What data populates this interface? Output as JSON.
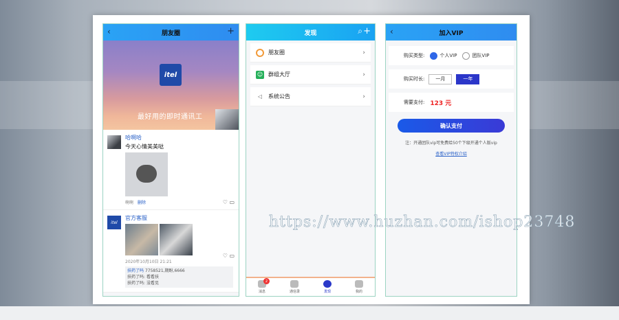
{
  "phone1": {
    "title": "朋友圈",
    "back_icon": "chevron-left-icon",
    "add_icon": "plus-icon",
    "logo_text": "itel",
    "slogan": "最好用的即时通讯工",
    "posts": [
      {
        "name": "哈啊哈",
        "text": "今天心情美美哒",
        "meta_user": "啊啊",
        "delete_label": "删除"
      },
      {
        "name": "官方客服",
        "date": "2020年10月10日 21:21",
        "comments": [
          {
            "user": "扶药了吗",
            "text": "7758521,期盼,6666"
          },
          {
            "user": "扶药了吗:",
            "text": "看看扶"
          },
          {
            "user": "扶药了吗:",
            "text": "没看见"
          }
        ]
      }
    ]
  },
  "phone2": {
    "title": "发现",
    "menu": [
      {
        "label": "朋友圈",
        "icon": "moments-icon"
      },
      {
        "label": "群组大厅",
        "icon": "group-hall-icon"
      },
      {
        "label": "系统公告",
        "icon": "speaker-icon"
      }
    ],
    "tabs": [
      {
        "label": "消息",
        "badge": "2"
      },
      {
        "label": "通信录",
        "badge": ""
      },
      {
        "label": "发现",
        "badge": ""
      },
      {
        "label": "我的",
        "badge": ""
      }
    ]
  },
  "phone3": {
    "title": "加入VIP",
    "type_label": "购买类型:",
    "type_personal": "个人VIP",
    "type_team": "团队VIP",
    "duration_label": "购买时长:",
    "duration_month": "一月",
    "duration_year": "一年",
    "pay_label": "需要支付:",
    "pay_amount": "123 元",
    "confirm_label": "确认支付",
    "note": "注：开通团队vip可免费给50个下级开通个人版vip",
    "link_label": "查看VIP特权介绍"
  },
  "watermark": "https://www.huzhan.com/ishop23748",
  "colors": {
    "accent": "#2f8cf0",
    "price": "#e22222",
    "tab_active": "#2b39c9"
  }
}
